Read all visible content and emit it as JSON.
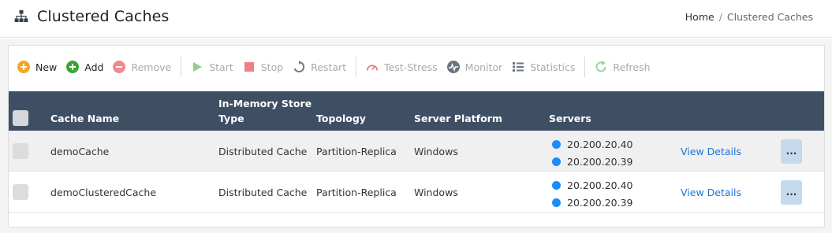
{
  "header": {
    "title": "Clustered Caches",
    "icon": "sitemap-icon",
    "breadcrumb": {
      "home": "Home",
      "separator": "/",
      "current": "Clustered Caches"
    }
  },
  "toolbar": {
    "buttons": [
      {
        "label": "New",
        "icon": "plus-circle-orange-icon",
        "enabled": true
      },
      {
        "label": "Add",
        "icon": "plus-circle-green-icon",
        "enabled": true
      },
      {
        "label": "Remove",
        "icon": "minus-circle-red-icon",
        "enabled": false
      },
      {
        "label": "Start",
        "icon": "play-icon",
        "enabled": false
      },
      {
        "label": "Stop",
        "icon": "stop-icon",
        "enabled": false
      },
      {
        "label": "Restart",
        "icon": "restart-icon",
        "enabled": false
      },
      {
        "label": "Test-Stress",
        "icon": "gauge-icon",
        "enabled": false
      },
      {
        "label": "Monitor",
        "icon": "monitor-icon",
        "enabled": false
      },
      {
        "label": "Statistics",
        "icon": "list-icon",
        "enabled": false
      },
      {
        "label": "Refresh",
        "icon": "refresh-icon",
        "enabled": false
      }
    ]
  },
  "table": {
    "columns": {
      "cache_name": "Cache Name",
      "store_type_line1": "In-Memory Store",
      "store_type_line2": "Type",
      "topology": "Topology",
      "platform": "Server Platform",
      "servers": "Servers"
    },
    "rows": [
      {
        "cache_name": "demoCache",
        "store_type": "Distributed Cache",
        "topology": "Partition-Replica",
        "platform": "Windows",
        "servers": [
          "20.200.20.40",
          "20.200.20.39"
        ],
        "details": "View Details",
        "more": "..."
      },
      {
        "cache_name": "demoClusteredCache",
        "store_type": "Distributed Cache",
        "topology": "Partition-Replica",
        "platform": "Windows",
        "servers": [
          "20.200.20.40",
          "20.200.20.39"
        ],
        "details": "View Details",
        "more": "..."
      }
    ]
  },
  "colors": {
    "header_bg": "#3f4f63",
    "server_status": "#1a8cff",
    "link": "#1a73d9"
  }
}
